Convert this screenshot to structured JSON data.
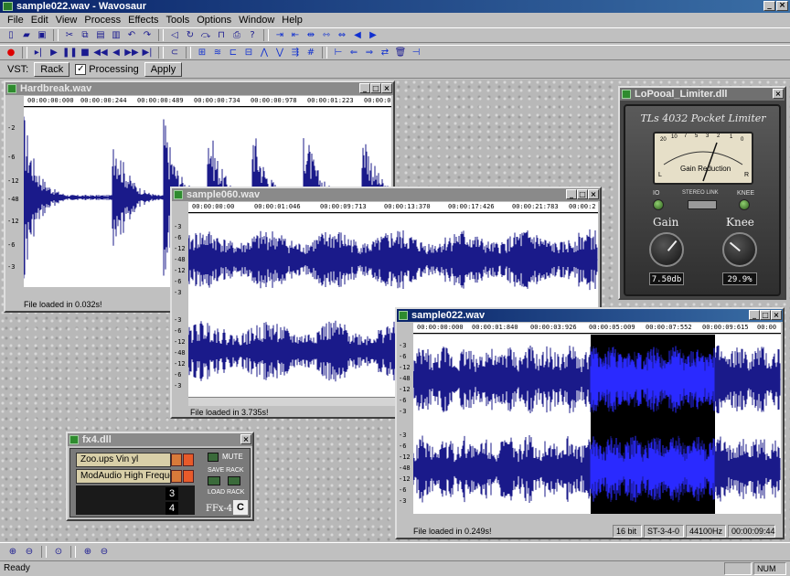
{
  "app": {
    "title": "sample022.wav - Wavosaur"
  },
  "menu": [
    "File",
    "Edit",
    "View",
    "Process",
    "Effects",
    "Tools",
    "Options",
    "Window",
    "Help"
  ],
  "vst_bar": {
    "label": "VST:",
    "rack_btn": "Rack",
    "processing_label": "Processing",
    "processing_checked": "✓",
    "apply_btn": "Apply"
  },
  "windows": {
    "hardbreak": {
      "title": "Hardbreak.wav",
      "ruler": [
        "00:00:00:000",
        "00:00:00:244",
        "00:00:00:489",
        "00:00:00:734",
        "00:00:00:978",
        "00:00:01:223",
        "00:00:01:468"
      ],
      "yaxis": [
        "-2",
        "-6",
        "-12",
        "-48",
        "-12",
        "-6",
        "-3"
      ],
      "status": "File loaded in 0.032s!"
    },
    "sample060": {
      "title": "sample060.wav",
      "ruler": [
        "00:00:00:00",
        "00:00:01:046",
        "00:00:09:713",
        "00:00:13:370",
        "00:00:17:426",
        "00:00:21:783",
        "00:00:2"
      ],
      "yaxis_top": [
        "-3",
        "-6",
        "-12",
        "-48",
        "-12",
        "-6",
        "-3"
      ],
      "yaxis_bottom": [
        "-3",
        "-6",
        "-12",
        "-48",
        "-12",
        "-6",
        "-3"
      ],
      "status": "File loaded in 3.735s!"
    },
    "sample022": {
      "title": "sample022.wav",
      "ruler": [
        "00:00:00:000",
        "00:00:01:840",
        "00:00:03:926",
        "00:00:05:009",
        "00:00:07:552",
        "00:00:09:615",
        "00:00"
      ],
      "yaxis_top": [
        "-3",
        "-6",
        "-12",
        "-48",
        "-12",
        "-6",
        "-3"
      ],
      "yaxis_bottom": [
        "-3",
        "-6",
        "-12",
        "-48",
        "-12",
        "-6",
        "-3"
      ],
      "status": "File loaded in 0.249s!",
      "status_panes": [
        "16 bit",
        "ST-3-4-0",
        "44100Hz",
        "00:00:09:44"
      ]
    },
    "limiter": {
      "title": "LoPooal_Limiter.dll",
      "brand": "TLs 4032 Pocket Limiter",
      "vu_label": "Gain Reduction",
      "vu_l": "L",
      "vu_r": "R",
      "scale": [
        "20",
        "10",
        "7",
        "5",
        "3",
        "2",
        "1",
        "0"
      ],
      "io_label": "IO",
      "stereo_link": "STEREO LINK",
      "knee_small": "KNEE",
      "gain_label": "Gain",
      "knee_label": "Knee",
      "gain_value": "7.50db",
      "knee_value": "29.9%"
    },
    "ffx": {
      "title": "fx4.dll",
      "slots": [
        "Zoo.ups Vin yl",
        "ModAudio High Frequency"
      ],
      "numbers": [
        "3",
        "4"
      ],
      "mute_btn": "MUTE",
      "save_rack": "SAVE RACK",
      "load_rack": "LOAD RACK",
      "brand": "FFx-4",
      "brand_letter": "C"
    }
  },
  "statusbar": {
    "text": "Ready",
    "num": "NUM"
  }
}
